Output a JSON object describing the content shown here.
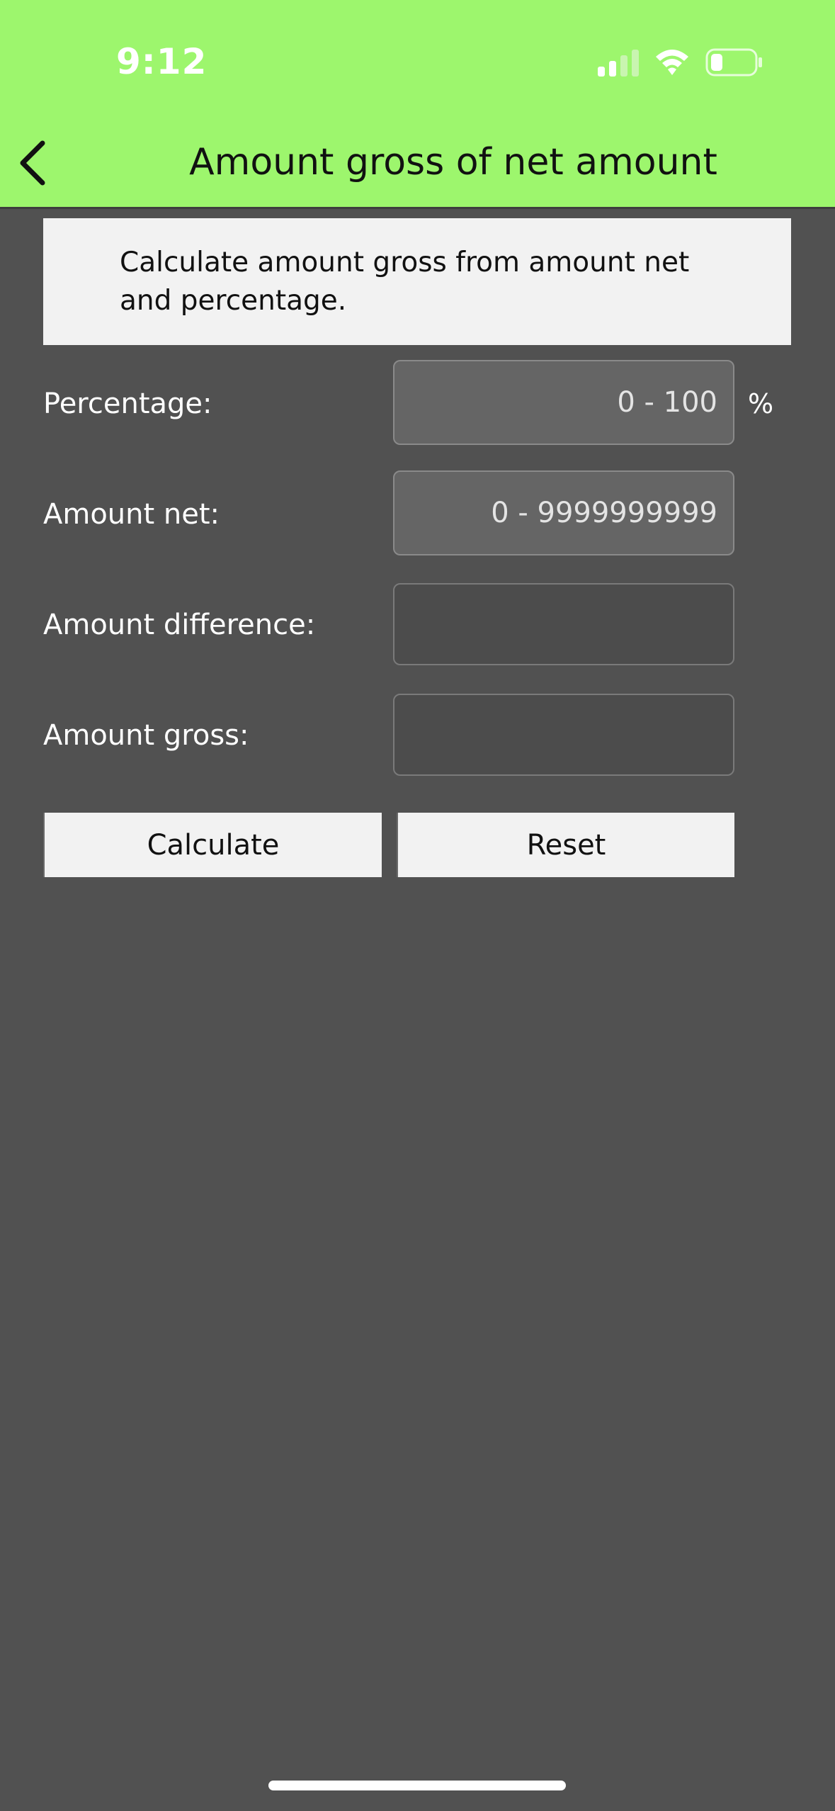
{
  "status_bar": {
    "time": "9:12",
    "icons": [
      "cellular-signal-icon",
      "wifi-icon",
      "battery-icon"
    ]
  },
  "header": {
    "title": "Amount gross of net amount",
    "back_icon": "chevron-left-icon",
    "background_color": "#9df66d"
  },
  "description": "Calculate amount gross from amount net and percentage.",
  "form": {
    "percentage": {
      "label": "Percentage:",
      "placeholder": "0 - 100",
      "unit": "%"
    },
    "amount_net": {
      "label": "Amount net:",
      "placeholder": "0 - 9999999999"
    },
    "amount_difference": {
      "label": "Amount difference:",
      "value": ""
    },
    "amount_gross": {
      "label": "Amount gross:",
      "value": ""
    }
  },
  "buttons": {
    "calculate": "Calculate",
    "reset": "Reset"
  },
  "colors": {
    "background": "#515151",
    "panel": "#f2f2f2",
    "input_enabled": "#656565"
  }
}
